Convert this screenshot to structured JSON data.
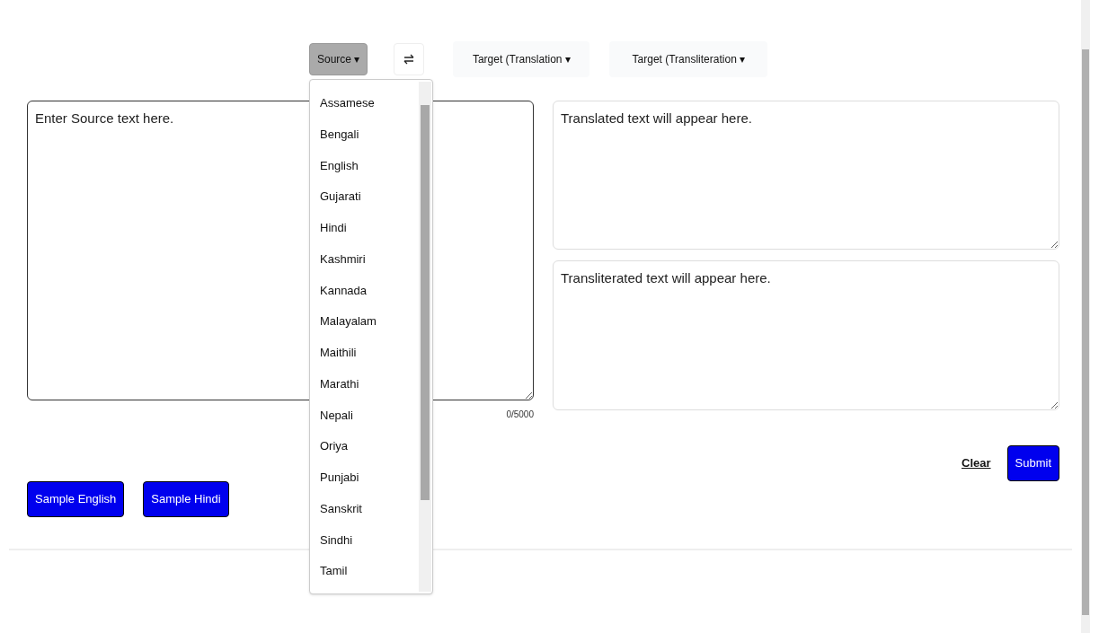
{
  "toolbar": {
    "source_button": "Source ▾",
    "target_translation_button": "Target (Translation ▾",
    "target_transliteration_button": "Target (Transliteration ▾"
  },
  "source_field": {
    "placeholder": "Enter Source text here.",
    "counter": "0/5000"
  },
  "translation_field": {
    "placeholder": "Translated text will appear here."
  },
  "transliteration_field": {
    "placeholder": "Transliterated text will appear here."
  },
  "actions": {
    "clear": "Clear",
    "submit": "Submit"
  },
  "samples": [
    "Sample English",
    "Sample Hindi"
  ],
  "source_dropdown": {
    "expanded": true,
    "items": [
      "Assamese",
      "Bengali",
      "English",
      "Gujarati",
      "Hindi",
      "Kashmiri",
      "Kannada",
      "Malayalam",
      "Maithili",
      "Marathi",
      "Nepali",
      "Oriya",
      "Punjabi",
      "Sanskrit",
      "Sindhi",
      "Tamil"
    ]
  }
}
